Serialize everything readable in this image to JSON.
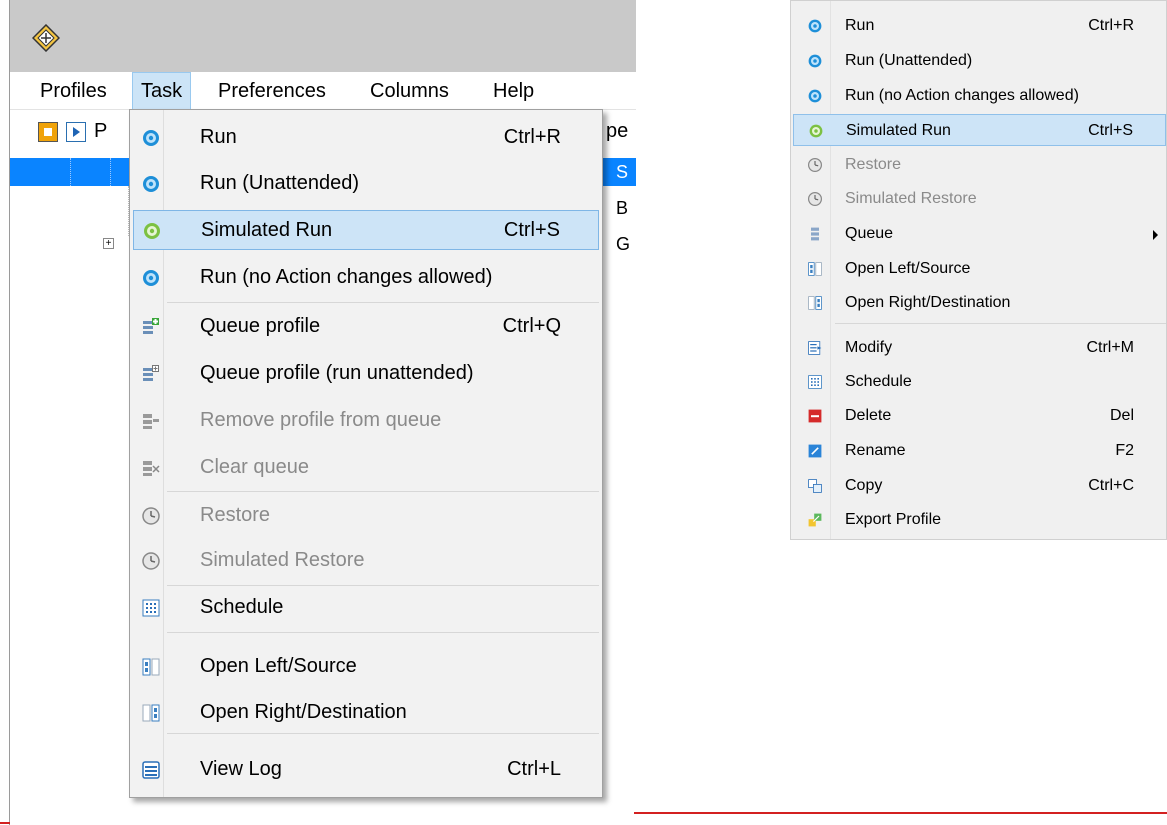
{
  "menubar": {
    "items": [
      {
        "label": "Profiles"
      },
      {
        "label": "Task"
      },
      {
        "label": "Preferences"
      },
      {
        "label": "Columns"
      },
      {
        "label": "Help"
      }
    ]
  },
  "background_fragments": {
    "toolbar_letter": "P",
    "column_header_fragment": "pe",
    "row_fragments": [
      "S",
      "B",
      "G"
    ]
  },
  "task_menu": {
    "items": [
      {
        "label": "Run",
        "shortcut": "Ctrl+R",
        "icon": "gear-icon"
      },
      {
        "label": "Run (Unattended)",
        "shortcut": "",
        "icon": "gear-icon"
      },
      {
        "label": "Simulated Run",
        "shortcut": "Ctrl+S",
        "icon": "gear-green-icon",
        "highlighted": true
      },
      {
        "label": "Run (no Action changes allowed)",
        "shortcut": "",
        "icon": "gear-icon"
      },
      {
        "label": "Queue profile",
        "shortcut": "Ctrl+Q",
        "icon": "queue-add-icon"
      },
      {
        "label": "Queue profile (run unattended)",
        "shortcut": "",
        "icon": "queue-add-outline-icon"
      },
      {
        "label": "Remove profile from queue",
        "shortcut": "",
        "icon": "queue-remove-icon",
        "disabled": true
      },
      {
        "label": "Clear queue",
        "shortcut": "",
        "icon": "queue-clear-icon",
        "disabled": true
      },
      {
        "label": "Restore",
        "shortcut": "",
        "icon": "clock-icon",
        "disabled": true
      },
      {
        "label": "Simulated Restore",
        "shortcut": "",
        "icon": "clock-icon",
        "disabled": true
      },
      {
        "label": "Schedule",
        "shortcut": "",
        "icon": "schedule-grid-icon"
      },
      {
        "label": "Open Left/Source",
        "shortcut": "",
        "icon": "open-left-icon"
      },
      {
        "label": "Open Right/Destination",
        "shortcut": "",
        "icon": "open-right-icon"
      },
      {
        "label": "View Log",
        "shortcut": "Ctrl+L",
        "icon": "log-icon"
      }
    ]
  },
  "context_menu": {
    "items": [
      {
        "label": "Run",
        "shortcut": "Ctrl+R",
        "icon": "gear-icon"
      },
      {
        "label": "Run (Unattended)",
        "shortcut": "",
        "icon": "gear-icon"
      },
      {
        "label": "Run (no Action changes allowed)",
        "shortcut": "",
        "icon": "gear-icon"
      },
      {
        "label": "Simulated Run",
        "shortcut": "Ctrl+S",
        "icon": "gear-green-icon",
        "highlighted": true
      },
      {
        "label": "Restore",
        "shortcut": "",
        "icon": "clock-icon",
        "disabled": true
      },
      {
        "label": "Simulated Restore",
        "shortcut": "",
        "icon": "clock-icon",
        "disabled": true
      },
      {
        "label": "Queue",
        "shortcut": "",
        "icon": "queue-icon",
        "submenu": true
      },
      {
        "label": "Open Left/Source",
        "shortcut": "",
        "icon": "open-left-icon"
      },
      {
        "label": "Open Right/Destination",
        "shortcut": "",
        "icon": "open-right-icon"
      },
      {
        "label": "Modify",
        "shortcut": "Ctrl+M",
        "icon": "modify-icon"
      },
      {
        "label": "Schedule",
        "shortcut": "",
        "icon": "schedule-grid-icon"
      },
      {
        "label": "Delete",
        "shortcut": "Del",
        "icon": "delete-icon"
      },
      {
        "label": "Rename",
        "shortcut": "F2",
        "icon": "rename-pencil-icon"
      },
      {
        "label": "Copy",
        "shortcut": "Ctrl+C",
        "icon": "copy-icon"
      },
      {
        "label": "Export Profile",
        "shortcut": "",
        "icon": "export-icon"
      }
    ]
  },
  "colors": {
    "highlight": "#cde4f7",
    "highlight_border": "#7fb6e6",
    "selection": "#0a84ff",
    "accent_gear": "#1e8fd8",
    "accent_green": "#7cc142",
    "disabled_text": "#8a8a8a"
  }
}
